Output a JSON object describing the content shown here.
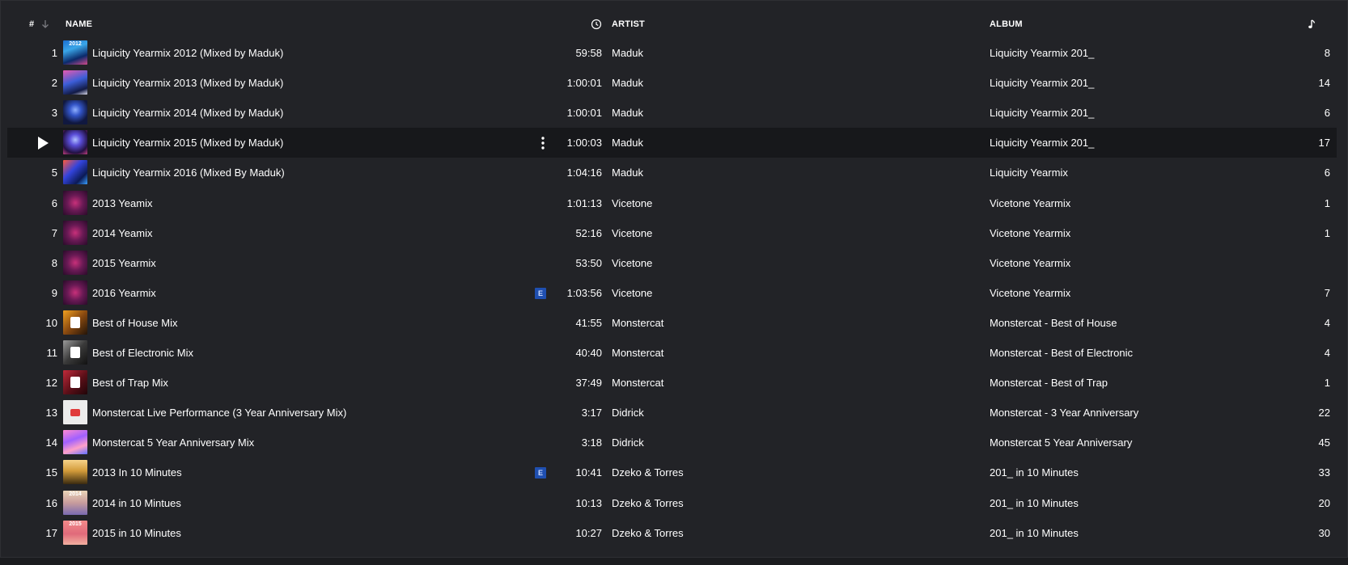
{
  "header": {
    "num": "#",
    "name": "NAME",
    "artist": "ARTIST",
    "album": "ALBUM"
  },
  "icons": {
    "sort": "arrow-down-icon",
    "duration": "clock-icon",
    "count": "music-note-icon",
    "play": "play-icon",
    "more": "more-vertical-icon"
  },
  "colors": {
    "background": "#222327",
    "active_row": "#17181b",
    "explicit_badge": "#1f4fb0",
    "header_muted": "#7a7b80"
  },
  "explicit_label": "E",
  "rows": [
    {
      "num": "1",
      "name": "Liquicity Yearmix 2012 (Mixed by Maduk)",
      "duration": "59:58",
      "artist": "Maduk",
      "album": "Liquicity Yearmix 201_",
      "count": "8",
      "art": "art-ly",
      "art_text": "2012",
      "explicit": false,
      "active": false
    },
    {
      "num": "2",
      "name": "Liquicity Yearmix 2013 (Mixed by Maduk)",
      "duration": "1:00:01",
      "artist": "Maduk",
      "album": "Liquicity Yearmix 201_",
      "count": "14",
      "art": "art-ly2",
      "art_text": "",
      "explicit": false,
      "active": false
    },
    {
      "num": "3",
      "name": "Liquicity Yearmix 2014 (Mixed by Maduk)",
      "duration": "1:00:01",
      "artist": "Maduk",
      "album": "Liquicity Yearmix 201_",
      "count": "6",
      "art": "art-ly3",
      "art_text": "",
      "explicit": false,
      "active": false
    },
    {
      "num": "",
      "name": "Liquicity Yearmix 2015 (Mixed by Maduk)",
      "duration": "1:00:03",
      "artist": "Maduk",
      "album": "Liquicity Yearmix 201_",
      "count": "17",
      "art": "art-ly4",
      "art_text": "",
      "explicit": false,
      "active": true
    },
    {
      "num": "5",
      "name": "Liquicity Yearmix 2016 (Mixed By Maduk)",
      "duration": "1:04:16",
      "artist": "Maduk",
      "album": "Liquicity Yearmix",
      "count": "6",
      "art": "art-ly5",
      "art_text": "",
      "explicit": false,
      "active": false
    },
    {
      "num": "6",
      "name": "2013 Yeamix",
      "duration": "1:01:13",
      "artist": "Vicetone",
      "album": "Vicetone Yearmix",
      "count": "1",
      "art": "art-vt",
      "art_text": "",
      "explicit": false,
      "active": false
    },
    {
      "num": "7",
      "name": "2014 Yeamix",
      "duration": "52:16",
      "artist": "Vicetone",
      "album": "Vicetone Yearmix",
      "count": "1",
      "art": "art-vt",
      "art_text": "",
      "explicit": false,
      "active": false
    },
    {
      "num": "8",
      "name": "2015 Yearmix",
      "duration": "53:50",
      "artist": "Vicetone",
      "album": "Vicetone Yearmix",
      "count": "",
      "art": "art-vt",
      "art_text": "",
      "explicit": false,
      "active": false
    },
    {
      "num": "9",
      "name": "2016 Yearmix",
      "duration": "1:03:56",
      "artist": "Vicetone",
      "album": "Vicetone Yearmix",
      "count": "7",
      "art": "art-vt",
      "art_text": "",
      "explicit": true,
      "active": false
    },
    {
      "num": "10",
      "name": "Best of House Mix",
      "duration": "41:55",
      "artist": "Monstercat",
      "album": "Monstercat - Best of House",
      "count": "4",
      "art": "art-mc-house",
      "art_text": "",
      "explicit": false,
      "active": false
    },
    {
      "num": "11",
      "name": "Best of Electronic Mix",
      "duration": "40:40",
      "artist": "Monstercat",
      "album": "Monstercat - Best of Electronic",
      "count": "4",
      "art": "art-mc-elec",
      "art_text": "",
      "explicit": false,
      "active": false
    },
    {
      "num": "12",
      "name": "Best of Trap Mix",
      "duration": "37:49",
      "artist": "Monstercat",
      "album": "Monstercat - Best of Trap",
      "count": "1",
      "art": "art-mc-trap",
      "art_text": "",
      "explicit": false,
      "active": false
    },
    {
      "num": "13",
      "name": "Monstercat Live Performance (3 Year Anniversary Mix)",
      "duration": "3:17",
      "artist": "Didrick",
      "album": "Monstercat - 3 Year Anniversary",
      "count": "22",
      "art": "art-live",
      "art_text": "",
      "explicit": false,
      "active": false
    },
    {
      "num": "14",
      "name": "Monstercat 5 Year Anniversary Mix",
      "duration": "3:18",
      "artist": "Didrick",
      "album": "Monstercat 5 Year Anniversary",
      "count": "45",
      "art": "art-5yr",
      "art_text": "",
      "explicit": false,
      "active": false
    },
    {
      "num": "15",
      "name": "2013 In 10 Minutes",
      "duration": "10:41",
      "artist": "Dzeko & Torres",
      "album": "201_ in 10 Minutes",
      "count": "33",
      "art": "art-10-13",
      "art_text": "",
      "explicit": true,
      "active": false
    },
    {
      "num": "16",
      "name": "2014 in 10 Mintues",
      "duration": "10:13",
      "artist": "Dzeko & Torres",
      "album": "201_ in 10 Minutes",
      "count": "20",
      "art": "art-10-14",
      "art_text": "2014",
      "explicit": false,
      "active": false
    },
    {
      "num": "17",
      "name": "2015 in 10 Minutes",
      "duration": "10:27",
      "artist": "Dzeko & Torres",
      "album": "201_ in 10 Minutes",
      "count": "30",
      "art": "art-10-15",
      "art_text": "2015",
      "explicit": false,
      "active": false
    }
  ]
}
